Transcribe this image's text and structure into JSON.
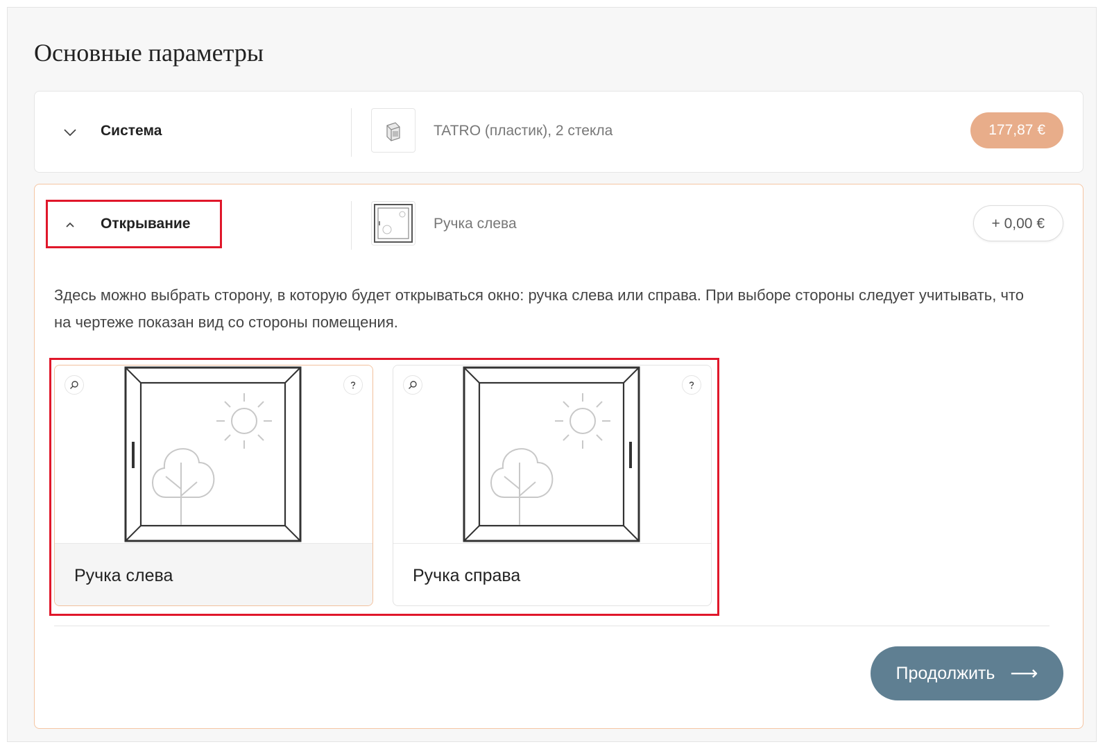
{
  "page": {
    "title": "Основные параметры"
  },
  "sections": {
    "system": {
      "label": "Система",
      "value": "TATRO (пластик), 2 стекла",
      "price": "177,87 €"
    },
    "opening": {
      "label": "Открывание",
      "value": "Ручка слева",
      "price": "+ 0,00 €",
      "description": "Здесь можно выбрать сторону, в которую будет открываться окно: ручка слева или справа. При выборе стороны следует учитывать, что на чертеже показан вид со стороны помещения.",
      "options": [
        {
          "label": "Ручка слева",
          "selected": true,
          "handle_side": "left"
        },
        {
          "label": "Ручка справа",
          "selected": false,
          "handle_side": "right"
        }
      ],
      "continue_label": "Продолжить"
    }
  },
  "icons": {
    "expand": "chevron-down-icon",
    "collapse": "chevron-up-icon",
    "zoom": "zoom-icon",
    "help": "help-icon",
    "arrow": "arrow-right-icon"
  },
  "colors": {
    "accent_price": "#e8ad8a",
    "active_border": "#f5c5a2",
    "continue_button": "#5f7f92",
    "highlight": "#e0172a"
  }
}
